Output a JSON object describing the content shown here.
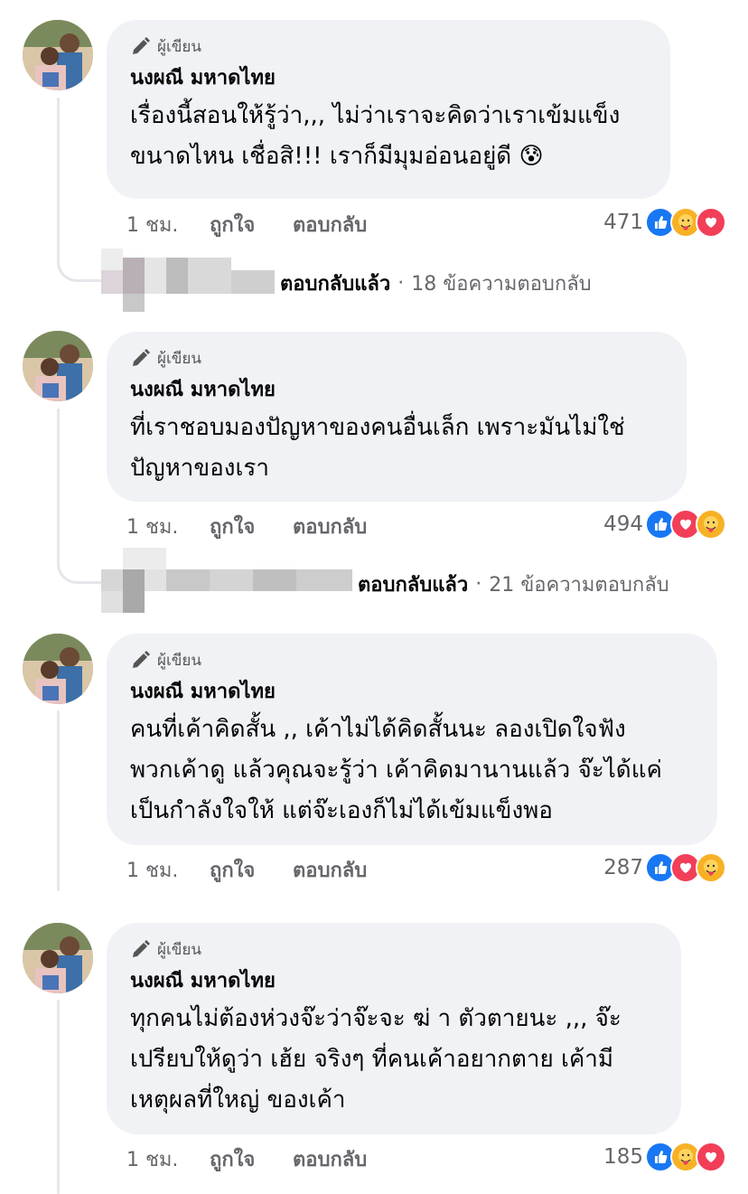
{
  "comments": [
    {
      "badge": "ผู้เขียน",
      "author": "นงผณี มหาดไทย",
      "lines": [
        "เรื่องนี้สอนให้รู้ว่า,,, ไม่ว่าเราจะคิดว่าเราเข้มแข็ง",
        "ขนาดไหน เชื่อสิ!!! เราก็มีมุมอ่อนอยู่ดี 😰"
      ],
      "time": "1 ชม.",
      "like": "ถูกใจ",
      "reply": "ตอบกลับ",
      "count": "471",
      "reactions": [
        "like",
        "care",
        "love"
      ],
      "replied_label": "ตอบกลับแล้ว",
      "reply_count": "18 ข้อความตอบกลับ"
    },
    {
      "badge": "ผู้เขียน",
      "author": "นงผณี มหาดไทย",
      "lines": [
        "ที่เราชอบมองปัญหาของคนอื่นเล็ก เพราะมันไม่ใช่",
        "ปัญหาของเรา"
      ],
      "time": "1 ชม.",
      "like": "ถูกใจ",
      "reply": "ตอบกลับ",
      "count": "494",
      "reactions": [
        "like",
        "love",
        "care"
      ],
      "replied_label": "ตอบกลับแล้ว",
      "reply_count": "21 ข้อความตอบกลับ"
    },
    {
      "badge": "ผู้เขียน",
      "author": "นงผณี มหาดไทย",
      "lines": [
        "คนที่เค้าคิดสั้น ,, เค้าไม่ได้คิดสั้นนะ ลองเปิดใจฟัง",
        "พวกเค้าดู แล้วคุณจะรู้ว่า เค้าคิดมานานแล้ว จ๊ะได้แค่",
        "เป็นกำลังใจให้ แต่จ๊ะเองก็ไม่ได้เข้มแข็งพอ"
      ],
      "time": "1 ชม.",
      "like": "ถูกใจ",
      "reply": "ตอบกลับ",
      "count": "287",
      "reactions": [
        "like",
        "love",
        "care"
      ]
    },
    {
      "badge": "ผู้เขียน",
      "author": "นงผณี มหาดไทย",
      "lines": [
        "ทุกคนไม่ต้องห่วงจ๊ะว่าจ๊ะจะ ฆ่ า ตัวตายนะ ,,, จ๊ะ",
        "เปรียบให้ดูว่า เฮ้ย จริงๆ ที่คนเค้าอยากตาย เค้ามี",
        "เหตุผลที่ใหญ่ ของเค้า"
      ],
      "time": "1 ชม.",
      "like": "ถูกใจ",
      "reply": "ตอบกลับ",
      "count": "185",
      "reactions": [
        "like",
        "care",
        "love"
      ]
    }
  ],
  "colors": {
    "like": "#1877f2",
    "love": "#f33e58",
    "care": "#f7b125",
    "bubble": "#f0f2f5"
  }
}
